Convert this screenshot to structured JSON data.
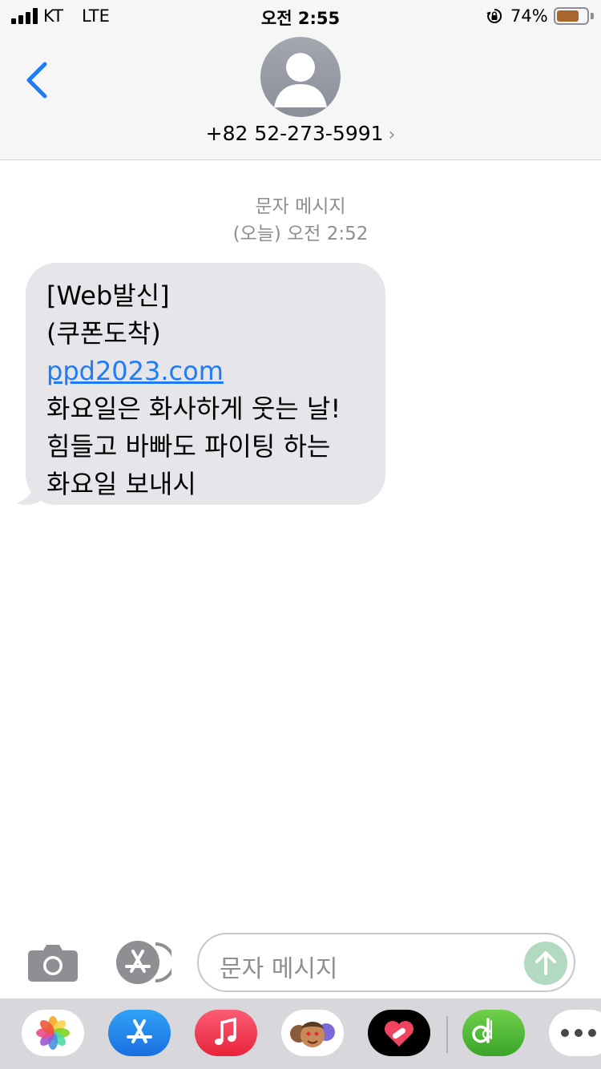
{
  "status_bar": {
    "carrier": "KT",
    "network": "LTE",
    "time": "오전 2:55",
    "battery_percent": "74%",
    "battery_level": 0.74,
    "battery_color": "#a8672a"
  },
  "header": {
    "back_icon": "chevron-left-icon",
    "avatar_icon": "person-silhouette-icon",
    "contact_name": "+82 52-273-5991",
    "contact_chevron": "›"
  },
  "conversation": {
    "message_type": "문자 메시지",
    "timestamp": "(오늘) 오전 2:52",
    "messages": [
      {
        "direction": "incoming",
        "lines": [
          "[Web발신]",
          "(쿠폰도착)"
        ],
        "link": "ppd2023.com",
        "body_lines": [
          "화요일은 화사하게 웃는 날!",
          "힘들고 바빠도 파이팅 하는",
          "화요일 보내시"
        ]
      }
    ]
  },
  "compose": {
    "camera_icon": "camera-icon",
    "appstore_icon": "app-store-icon",
    "input_placeholder": "문자 메시지",
    "send_icon": "arrow-up-icon"
  },
  "app_drawer": {
    "apps": [
      {
        "name": "photos-app-icon"
      },
      {
        "name": "app-store-app-icon"
      },
      {
        "name": "music-app-icon"
      },
      {
        "name": "memoji-app-icon"
      },
      {
        "name": "fitness-app-icon"
      },
      {
        "name": "b-app-icon"
      },
      {
        "name": "more-apps-icon"
      }
    ]
  },
  "colors": {
    "accent": "#1f7bf6",
    "bubble": "#e5e5ea",
    "send_disabled": "#b2dac1"
  }
}
